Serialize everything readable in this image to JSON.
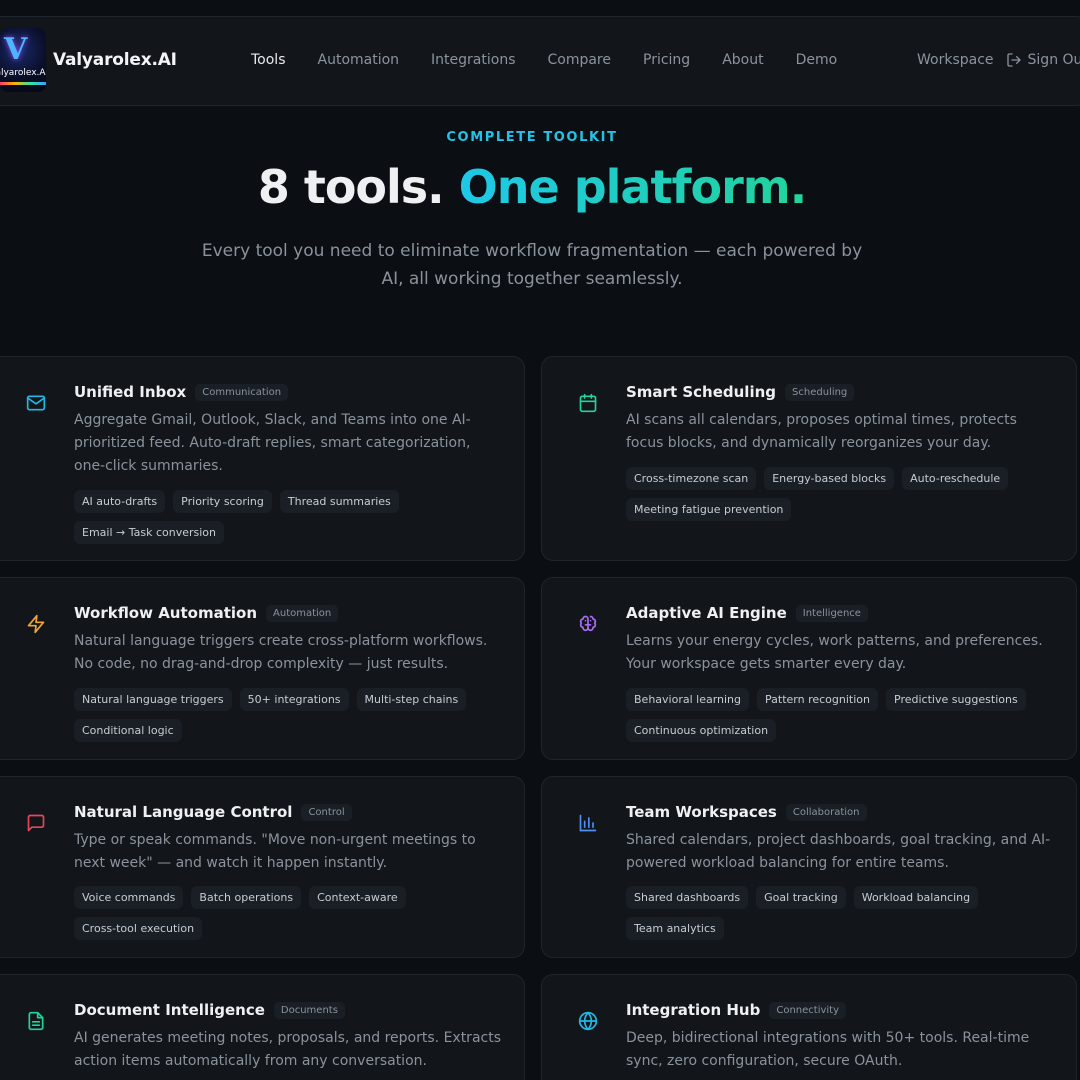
{
  "brand": {
    "name": "Valyarolex.AI",
    "logo_text": "Valyarolex.AI",
    "logo_icon": "v-logo-icon"
  },
  "nav": {
    "links": [
      "Tools",
      "Automation",
      "Integrations",
      "Compare",
      "Pricing",
      "About",
      "Demo"
    ],
    "active": "Tools",
    "workspace": "Workspace",
    "sign_out": "Sign Out"
  },
  "hero": {
    "eyebrow": "COMPLETE TOOLKIT",
    "title_plain": "8 tools.",
    "title_accent": "One platform.",
    "subtitle": "Every tool you need to eliminate workflow fragmentation — each powered by AI, all working together seamlessly."
  },
  "colors": {
    "background": "#0b0e12",
    "card": "#12161b",
    "accent_cyan": "#1ec8e8",
    "accent_green": "#22d39a"
  },
  "tools": [
    {
      "title": "Unified Inbox",
      "badge": "Communication",
      "icon": "mail-icon",
      "icon_color": "#22b8e6",
      "desc": "Aggregate Gmail, Outlook, Slack, and Teams into one AI-prioritized feed. Auto-draft replies, smart categorization, one-click summaries.",
      "tags": [
        "AI auto-drafts",
        "Priority scoring",
        "Thread summaries",
        "Email → Task conversion"
      ]
    },
    {
      "title": "Smart Scheduling",
      "badge": "Scheduling",
      "icon": "calendar-icon",
      "icon_color": "#22d39a",
      "desc": "AI scans all calendars, proposes optimal times, protects focus blocks, and dynamically reorganizes your day.",
      "tags": [
        "Cross-timezone scan",
        "Energy-based blocks",
        "Auto-reschedule",
        "Meeting fatigue prevention"
      ]
    },
    {
      "title": "Workflow Automation",
      "badge": "Automation",
      "icon": "lightning-icon",
      "icon_color": "#f2a531",
      "desc": "Natural language triggers create cross-platform workflows. No code, no drag-and-drop complexity — just results.",
      "tags": [
        "Natural language triggers",
        "50+ integrations",
        "Multi-step chains",
        "Conditional logic"
      ]
    },
    {
      "title": "Adaptive AI Engine",
      "badge": "Intelligence",
      "icon": "brain-icon",
      "icon_color": "#a86cf2",
      "desc": "Learns your energy cycles, work patterns, and preferences. Your workspace gets smarter every day.",
      "tags": [
        "Behavioral learning",
        "Pattern recognition",
        "Predictive suggestions",
        "Continuous optimization"
      ]
    },
    {
      "title": "Natural Language Control",
      "badge": "Control",
      "icon": "chat-icon",
      "icon_color": "#e5485e",
      "desc": "Type or speak commands. \"Move non-urgent meetings to next week\" — and watch it happen instantly.",
      "tags": [
        "Voice commands",
        "Batch operations",
        "Context-aware",
        "Cross-tool execution"
      ]
    },
    {
      "title": "Team Workspaces",
      "badge": "Collaboration",
      "icon": "bar-chart-icon",
      "icon_color": "#4f8ff2",
      "desc": "Shared calendars, project dashboards, goal tracking, and AI-powered workload balancing for entire teams.",
      "tags": [
        "Shared dashboards",
        "Goal tracking",
        "Workload balancing",
        "Team analytics"
      ]
    },
    {
      "title": "Document Intelligence",
      "badge": "Documents",
      "icon": "document-icon",
      "icon_color": "#22d39a",
      "desc": "AI generates meeting notes, proposals, and reports. Extracts action items automatically from any conversation.",
      "tags": []
    },
    {
      "title": "Integration Hub",
      "badge": "Connectivity",
      "icon": "globe-icon",
      "icon_color": "#22b8e6",
      "desc": "Deep, bidirectional integrations with 50+ tools. Real-time sync, zero configuration, secure OAuth.",
      "tags": []
    }
  ]
}
